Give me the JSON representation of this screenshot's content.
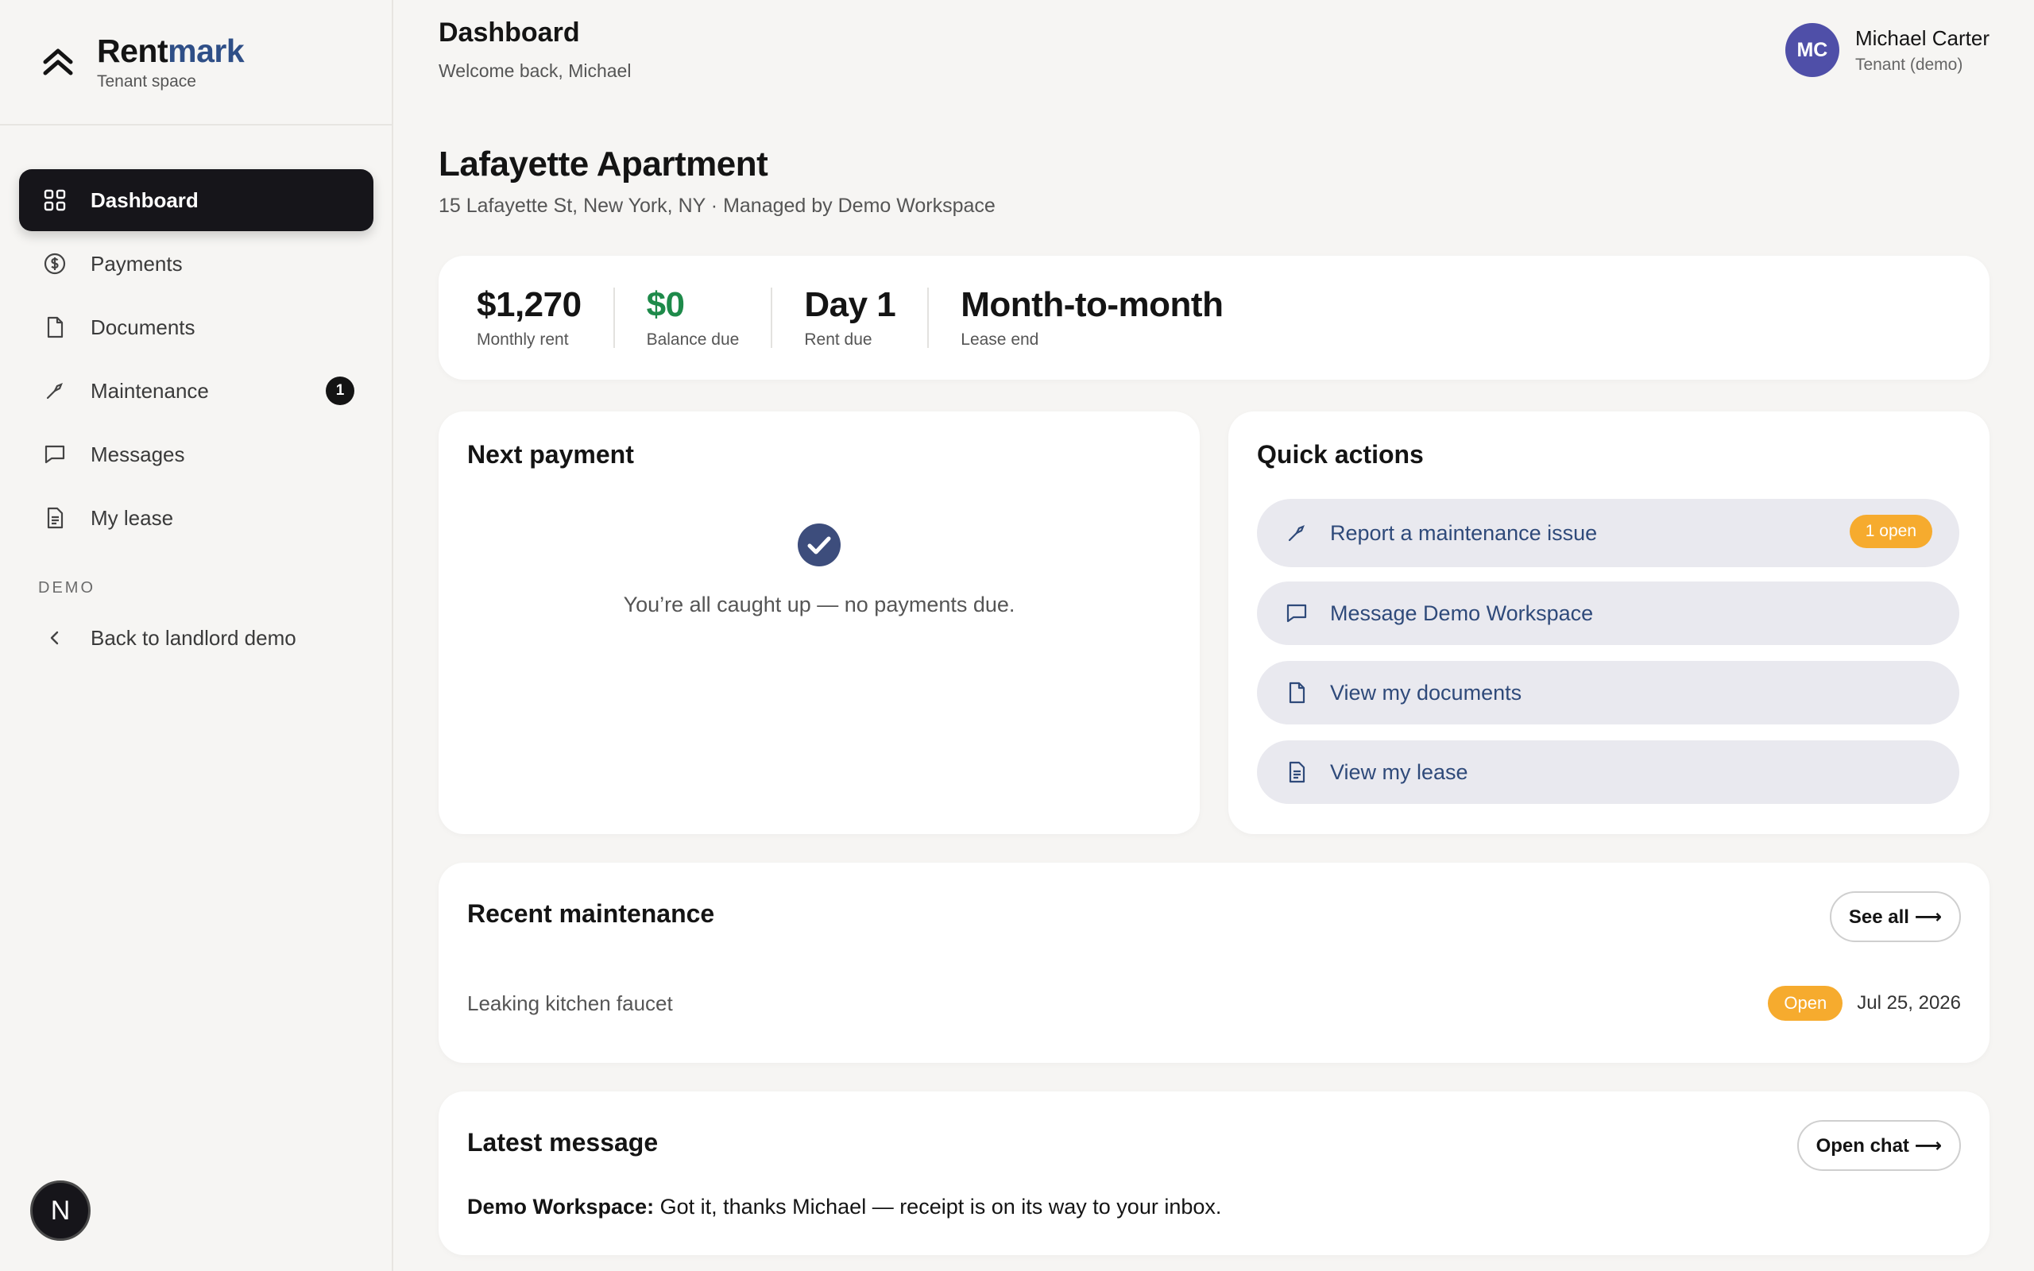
{
  "brand": {
    "name_part1": "Rent",
    "name_part2": "mark",
    "subtitle": "Tenant space"
  },
  "sidebar": {
    "items": [
      {
        "label": "Dashboard",
        "icon": "grid-icon",
        "active": true
      },
      {
        "label": "Payments",
        "icon": "dollar-circle-icon"
      },
      {
        "label": "Documents",
        "icon": "document-icon"
      },
      {
        "label": "Maintenance",
        "icon": "wrench-icon",
        "badge": "1"
      },
      {
        "label": "Messages",
        "icon": "chat-icon"
      },
      {
        "label": "My lease",
        "icon": "file-text-icon"
      }
    ],
    "section_label": "DEMO",
    "back_label": "Back to landlord demo",
    "footer_letter": "N"
  },
  "header": {
    "title": "Dashboard",
    "welcome": "Welcome back, Michael"
  },
  "user": {
    "initials": "MC",
    "name": "Michael Carter",
    "role": "Tenant (demo)"
  },
  "property": {
    "title": "Lafayette Apartment",
    "subtitle": "15 Lafayette St, New York, NY · Managed by Demo Workspace"
  },
  "stats": [
    {
      "value": "$1,270",
      "label": "Monthly rent"
    },
    {
      "value": "$0",
      "label": "Balance due"
    },
    {
      "value": "Day 1",
      "label": "Rent due"
    },
    {
      "value": "Month-to-month",
      "label": "Lease end"
    }
  ],
  "next_payment": {
    "title": "Next payment",
    "message": "You’re all caught up — no payments due."
  },
  "quick_actions": {
    "title": "Quick actions",
    "items": [
      {
        "label": "Report a maintenance issue",
        "icon": "wrench-icon",
        "badge": "1 open"
      },
      {
        "label": "Message Demo Workspace",
        "icon": "chat-icon"
      },
      {
        "label": "View my documents",
        "icon": "document-icon"
      },
      {
        "label": "View my lease",
        "icon": "file-text-icon"
      }
    ]
  },
  "recent_maintenance": {
    "title": "Recent maintenance",
    "see_all": "See all ⟶",
    "item": {
      "title": "Leaking kitchen faucet",
      "status": "Open",
      "date": "Jul 25, 2026"
    }
  },
  "latest_message": {
    "title": "Latest message",
    "open_chat": "Open chat ⟶",
    "sender": "Demo Workspace:",
    "text": " Got it, thanks Michael — receipt is on its way to your inbox."
  },
  "colors": {
    "accent": "#2f4f87",
    "warning": "#f6ab2e",
    "positive": "#1e8a4a",
    "active_nav": "#16151a"
  }
}
